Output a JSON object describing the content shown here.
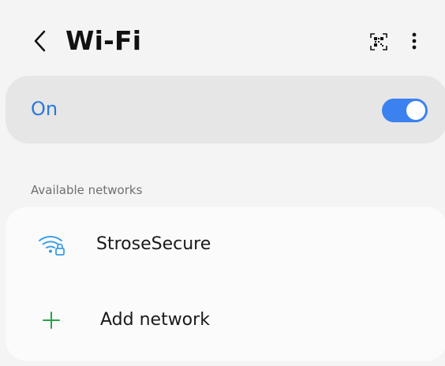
{
  "header": {
    "title": "Wi-Fi",
    "back_icon": "chevron-left-icon",
    "qr_icon": "qr-code-icon",
    "more_icon": "more-vertical-icon"
  },
  "wifi_toggle": {
    "label": "On",
    "state": "on",
    "accent_color": "#2979d6",
    "toggle_color": "#3b82f0"
  },
  "available_networks": {
    "section_label": "Available networks",
    "networks": [
      {
        "name": "StroseSecure",
        "icon": "wifi-lock-icon",
        "secured": true
      }
    ],
    "add_network": {
      "label": "Add network",
      "icon": "plus-icon",
      "icon_color": "#2aa24a"
    }
  }
}
